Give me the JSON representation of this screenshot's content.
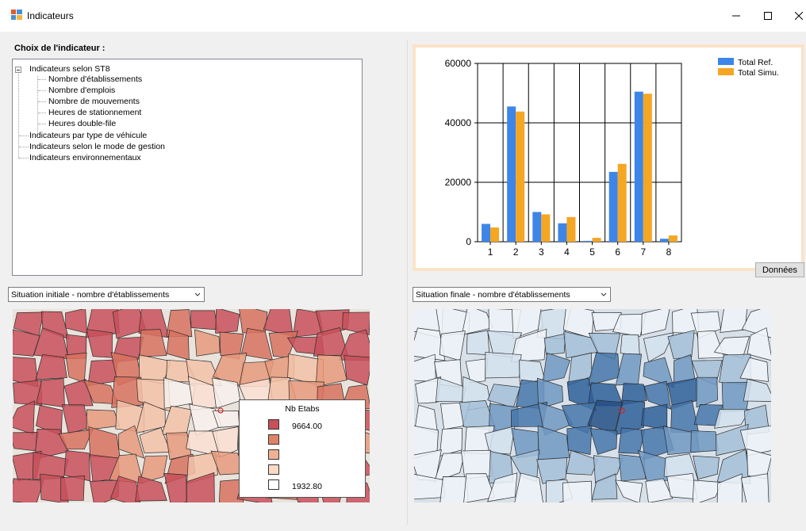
{
  "window": {
    "title": "Indicateurs",
    "buttons": {
      "minimize": "minimize-icon",
      "maximize": "maximize-icon",
      "close": "close-icon"
    }
  },
  "selector": {
    "label": "Choix de l'indicateur :",
    "tree": [
      {
        "label": "Indicateurs selon ST8",
        "expanded": true,
        "children": [
          "Nombre d'établissements",
          "Nombre d'emplois",
          "Nombre de mouvements",
          "Heures de stationnement",
          "Heures double-file"
        ]
      },
      {
        "label": "Indicateurs par type de véhicule"
      },
      {
        "label": "Indicateurs selon le mode de gestion"
      },
      {
        "label": "Indicateurs environnementaux"
      }
    ]
  },
  "chart_data": {
    "type": "bar",
    "categories": [
      "1",
      "2",
      "3",
      "4",
      "5",
      "6",
      "7",
      "8"
    ],
    "series": [
      {
        "name": "Total Ref.",
        "color": "#3d86e8",
        "values": [
          6000,
          45500,
          10000,
          6200,
          300,
          23500,
          50500,
          1000
        ]
      },
      {
        "name": "Total Simu.",
        "color": "#f5a623",
        "values": [
          4800,
          43800,
          9200,
          8300,
          1300,
          26200,
          49800,
          2100
        ]
      }
    ],
    "yticks": [
      "60000",
      "40000",
      "20000",
      "0"
    ],
    "ylim": [
      0,
      60000
    ],
    "grid": true,
    "legend": "top-right"
  },
  "data_button": {
    "label": "Données"
  },
  "left_map": {
    "combo_value": "Situation initiale - nombre d'établissements",
    "palette": "reds",
    "legend": {
      "title": "Nb Etabs",
      "colors": [
        "#c8505a",
        "#de8368",
        "#f0b193",
        "#fad9c5",
        "#ffffff"
      ],
      "max_label": "9664.00",
      "min_label": "1932.80"
    }
  },
  "right_map": {
    "combo_value": "Situation finale - nombre d'établissements",
    "palette": "blues"
  }
}
